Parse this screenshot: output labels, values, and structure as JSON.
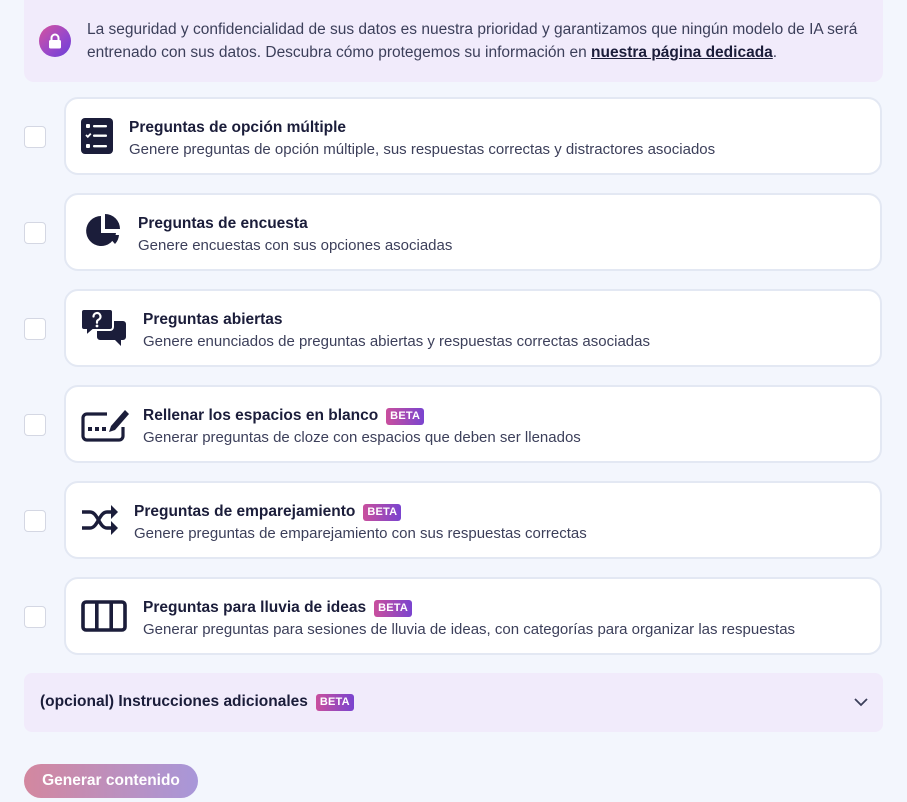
{
  "banner": {
    "text_before": "La seguridad y confidencialidad de sus datos es nuestra prioridad y garantizamos que ningún modelo de IA será entrenado con sus datos. Descubra cómo protegemos su información en ",
    "link": "nuestra página dedicada",
    "text_after": ".",
    "icon": "lock-icon"
  },
  "options": [
    {
      "title": "Preguntas de opción múltiple",
      "description": "Genere preguntas de opción múltiple, sus respuestas correctas y distractores asociados",
      "icon": "list-icon",
      "beta": ""
    },
    {
      "title": "Preguntas de encuesta",
      "description": "Genere encuestas con sus opciones asociadas",
      "icon": "pie-chart-icon",
      "beta": ""
    },
    {
      "title": "Preguntas abiertas",
      "description": "Genere enunciados de preguntas abiertas y respuestas correctas asociadas",
      "icon": "question-bubble-icon",
      "beta": ""
    },
    {
      "title": "Rellenar los espacios en blanco",
      "description": "Generar preguntas de cloze con espacios que deben ser llenados",
      "icon": "fill-blank-pen-icon",
      "beta": "BETA"
    },
    {
      "title": "Preguntas de emparejamiento",
      "description": "Genere preguntas de emparejamiento con sus respuestas correctas",
      "icon": "shuffle-icon",
      "beta": "BETA"
    },
    {
      "title": "Preguntas para lluvia de ideas",
      "description": "Generar preguntas para sesiones de lluvia de ideas, con categorías para organizar las respuestas",
      "icon": "columns-icon",
      "beta": "BETA"
    }
  ],
  "optional": {
    "label": "(opcional) Instrucciones adicionales",
    "beta": "BETA",
    "icon": "chevron-down-icon"
  },
  "generate_button": "Generar contenido",
  "colors": {
    "background": "#f3f6fd",
    "banner_bg": "#f1ebfb",
    "text_dark": "#1b1d3a",
    "beta_gradient_start": "#c94f9d",
    "beta_gradient_end": "#7a44cf"
  }
}
